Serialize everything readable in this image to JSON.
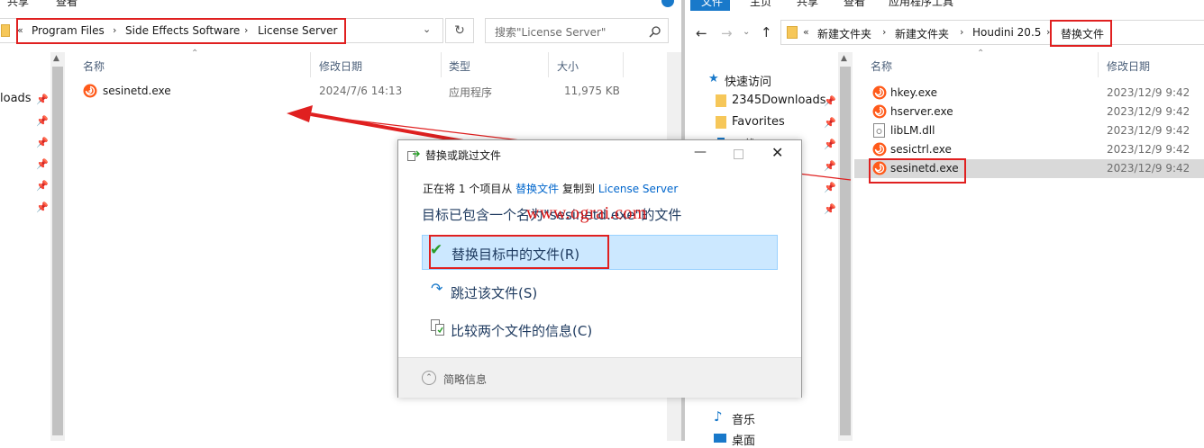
{
  "left_window": {
    "ribbon_tabs": [
      "共享",
      "查看"
    ],
    "breadcrumb": [
      "Program Files",
      "Side Effects Software",
      "License Server"
    ],
    "search_placeholder": "搜索\"License Server\"",
    "columns": {
      "name": "名称",
      "date": "修改日期",
      "type": "类型",
      "size": "大小"
    },
    "files": [
      {
        "name": "sesinetd.exe",
        "date": "2024/7/6 14:13",
        "type": "应用程序",
        "size": "11,975 KB"
      }
    ],
    "nav_partial": "loads"
  },
  "right_window": {
    "ribbon_tabs": [
      "文件",
      "主页",
      "共享",
      "查看",
      "应用程序工具"
    ],
    "breadcrumb": [
      "新建文件夹",
      "新建文件夹",
      "Houdini 20.5",
      "替换文件"
    ],
    "nav": {
      "quick_access": "快速访问",
      "items": [
        "2345Downloads",
        "Favorites",
        "下载"
      ],
      "music": "音乐",
      "desktop": "桌面"
    },
    "columns": {
      "name": "名称",
      "date": "修改日期"
    },
    "files": [
      {
        "name": "hkey.exe",
        "date": "2023/12/9 9:42",
        "icon": "houdini-icon"
      },
      {
        "name": "hserver.exe",
        "date": "2023/12/9 9:42",
        "icon": "houdini-icon"
      },
      {
        "name": "libLM.dll",
        "date": "2023/12/9 9:42",
        "icon": "dll-icon"
      },
      {
        "name": "sesictrl.exe",
        "date": "2023/12/9 9:42",
        "icon": "houdini-icon"
      },
      {
        "name": "sesinetd.exe",
        "date": "2023/12/9 9:42",
        "icon": "houdini-icon",
        "selected": true
      }
    ]
  },
  "dialog": {
    "title": "替换或跳过文件",
    "info": {
      "prefix": "正在将",
      "count": "1",
      "middle": "个项目从",
      "source": "替换文件",
      "copy_to": "复制到",
      "dest": "License Server"
    },
    "heading": "目标已包含一个名为\"sesinetd.exe\"的文件",
    "options": {
      "replace": "替换目标中的文件(R)",
      "skip": "跳过该文件(S)",
      "compare": "比较两个文件的信息(C)"
    },
    "less_info": "简略信息"
  },
  "watermark": "www.ograi.com",
  "colors": {
    "accent": "#0078d7",
    "annotation_red": "#e02020",
    "selected_option": "#cce8ff",
    "selected_row": "#d9d9d9"
  }
}
